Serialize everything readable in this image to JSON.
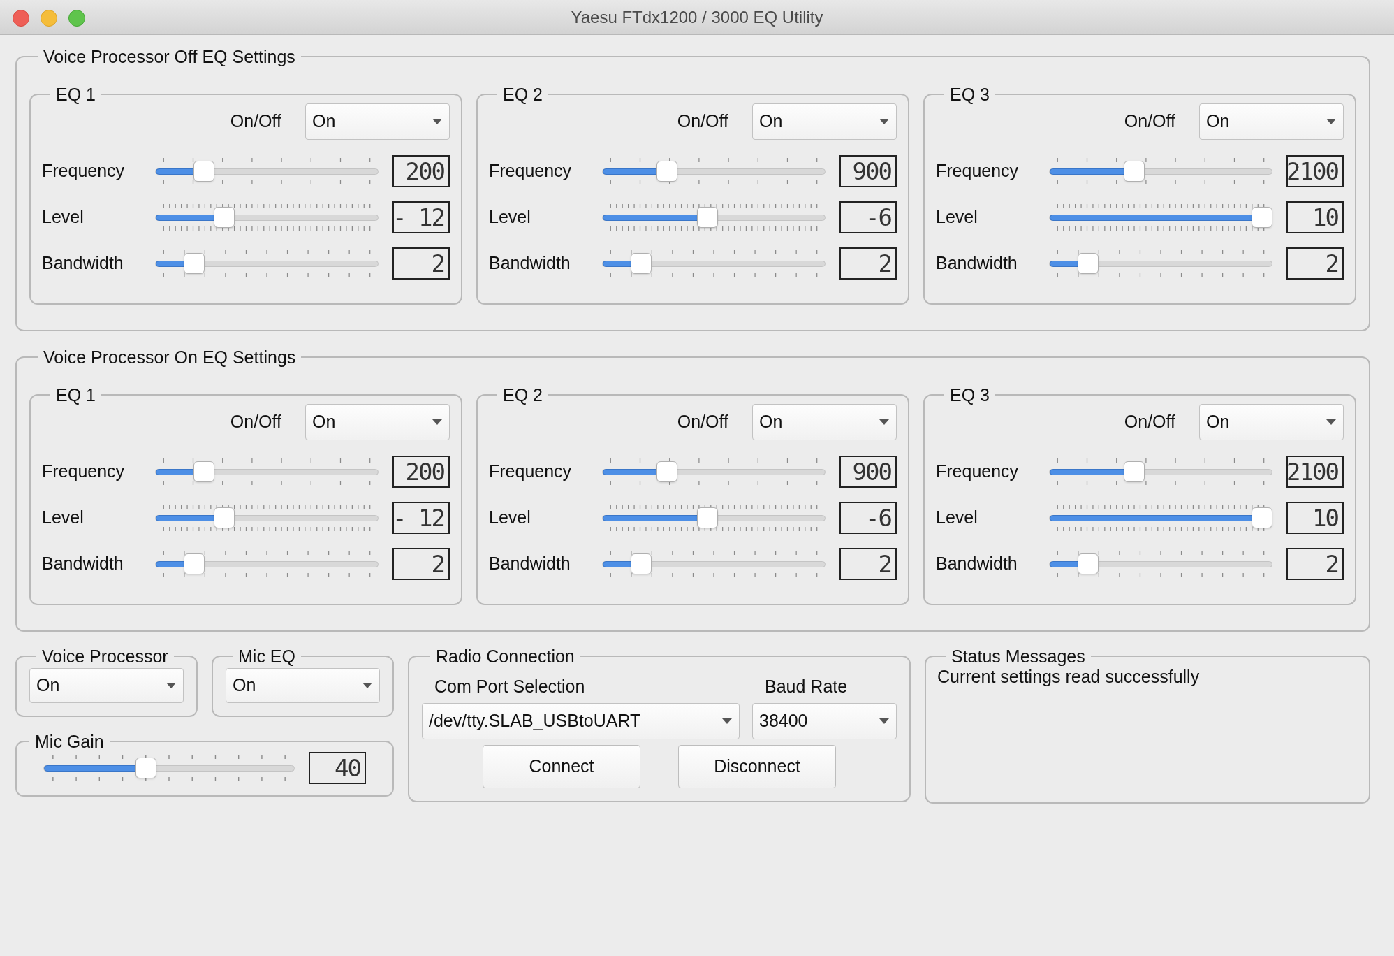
{
  "window": {
    "title": "Yaesu FTdx1200 / 3000 EQ Utility"
  },
  "sections": [
    {
      "title": "Voice Processor Off EQ Settings",
      "eqs": [
        {
          "title": "EQ 1",
          "onoff_label": "On/Off",
          "onoff_value": "On",
          "rows": [
            {
              "label": "Frequency",
              "level": 0.19,
              "reading": "200"
            },
            {
              "label": "Level",
              "level": 0.29,
              "reading": "- 12"
            },
            {
              "label": "Bandwidth",
              "level": 0.14,
              "reading": "2"
            }
          ]
        },
        {
          "title": "EQ 2",
          "onoff_label": "On/Off",
          "onoff_value": "On",
          "rows": [
            {
              "label": "Frequency",
              "level": 0.27,
              "reading": "900"
            },
            {
              "label": "Level",
              "level": 0.47,
              "reading": "-6"
            },
            {
              "label": "Bandwidth",
              "level": 0.14,
              "reading": "2"
            }
          ]
        },
        {
          "title": "EQ 3",
          "onoff_label": "On/Off",
          "onoff_value": "On",
          "rows": [
            {
              "label": "Frequency",
              "level": 0.37,
              "reading": "2100"
            },
            {
              "label": "Level",
              "level": 1.0,
              "reading": "10"
            },
            {
              "label": "Bandwidth",
              "level": 0.14,
              "reading": "2"
            }
          ]
        }
      ]
    },
    {
      "title": "Voice Processor On EQ Settings",
      "eqs": [
        {
          "title": "EQ 1",
          "onoff_label": "On/Off",
          "onoff_value": "On",
          "rows": [
            {
              "label": "Frequency",
              "level": 0.19,
              "reading": "200"
            },
            {
              "label": "Level",
              "level": 0.29,
              "reading": "- 12"
            },
            {
              "label": "Bandwidth",
              "level": 0.14,
              "reading": "2"
            }
          ]
        },
        {
          "title": "EQ 2",
          "onoff_label": "On/Off",
          "onoff_value": "On",
          "rows": [
            {
              "label": "Frequency",
              "level": 0.27,
              "reading": "900"
            },
            {
              "label": "Level",
              "level": 0.47,
              "reading": "-6"
            },
            {
              "label": "Bandwidth",
              "level": 0.14,
              "reading": "2"
            }
          ]
        },
        {
          "title": "EQ 3",
          "onoff_label": "On/Off",
          "onoff_value": "On",
          "rows": [
            {
              "label": "Frequency",
              "level": 0.37,
              "reading": "2100"
            },
            {
              "label": "Level",
              "level": 1.0,
              "reading": "10"
            },
            {
              "label": "Bandwidth",
              "level": 0.14,
              "reading": "2"
            }
          ]
        }
      ]
    }
  ],
  "voice_processor": {
    "title": "Voice Processor",
    "value": "On"
  },
  "mic_eq": {
    "title": "Mic EQ",
    "value": "On"
  },
  "mic_gain": {
    "title": "Mic Gain",
    "level": 0.4,
    "reading": "40"
  },
  "radio_connection": {
    "title": "Radio Connection",
    "com_port_label": "Com Port Selection",
    "com_port_value": "/dev/tty.SLAB_USBtoUART",
    "baud_label": "Baud Rate",
    "baud_value": "38400",
    "buttons": [
      "Connect",
      "Disconnect"
    ]
  },
  "status_messages": {
    "title": "Status Messages",
    "message": "Current settings read successfully"
  }
}
